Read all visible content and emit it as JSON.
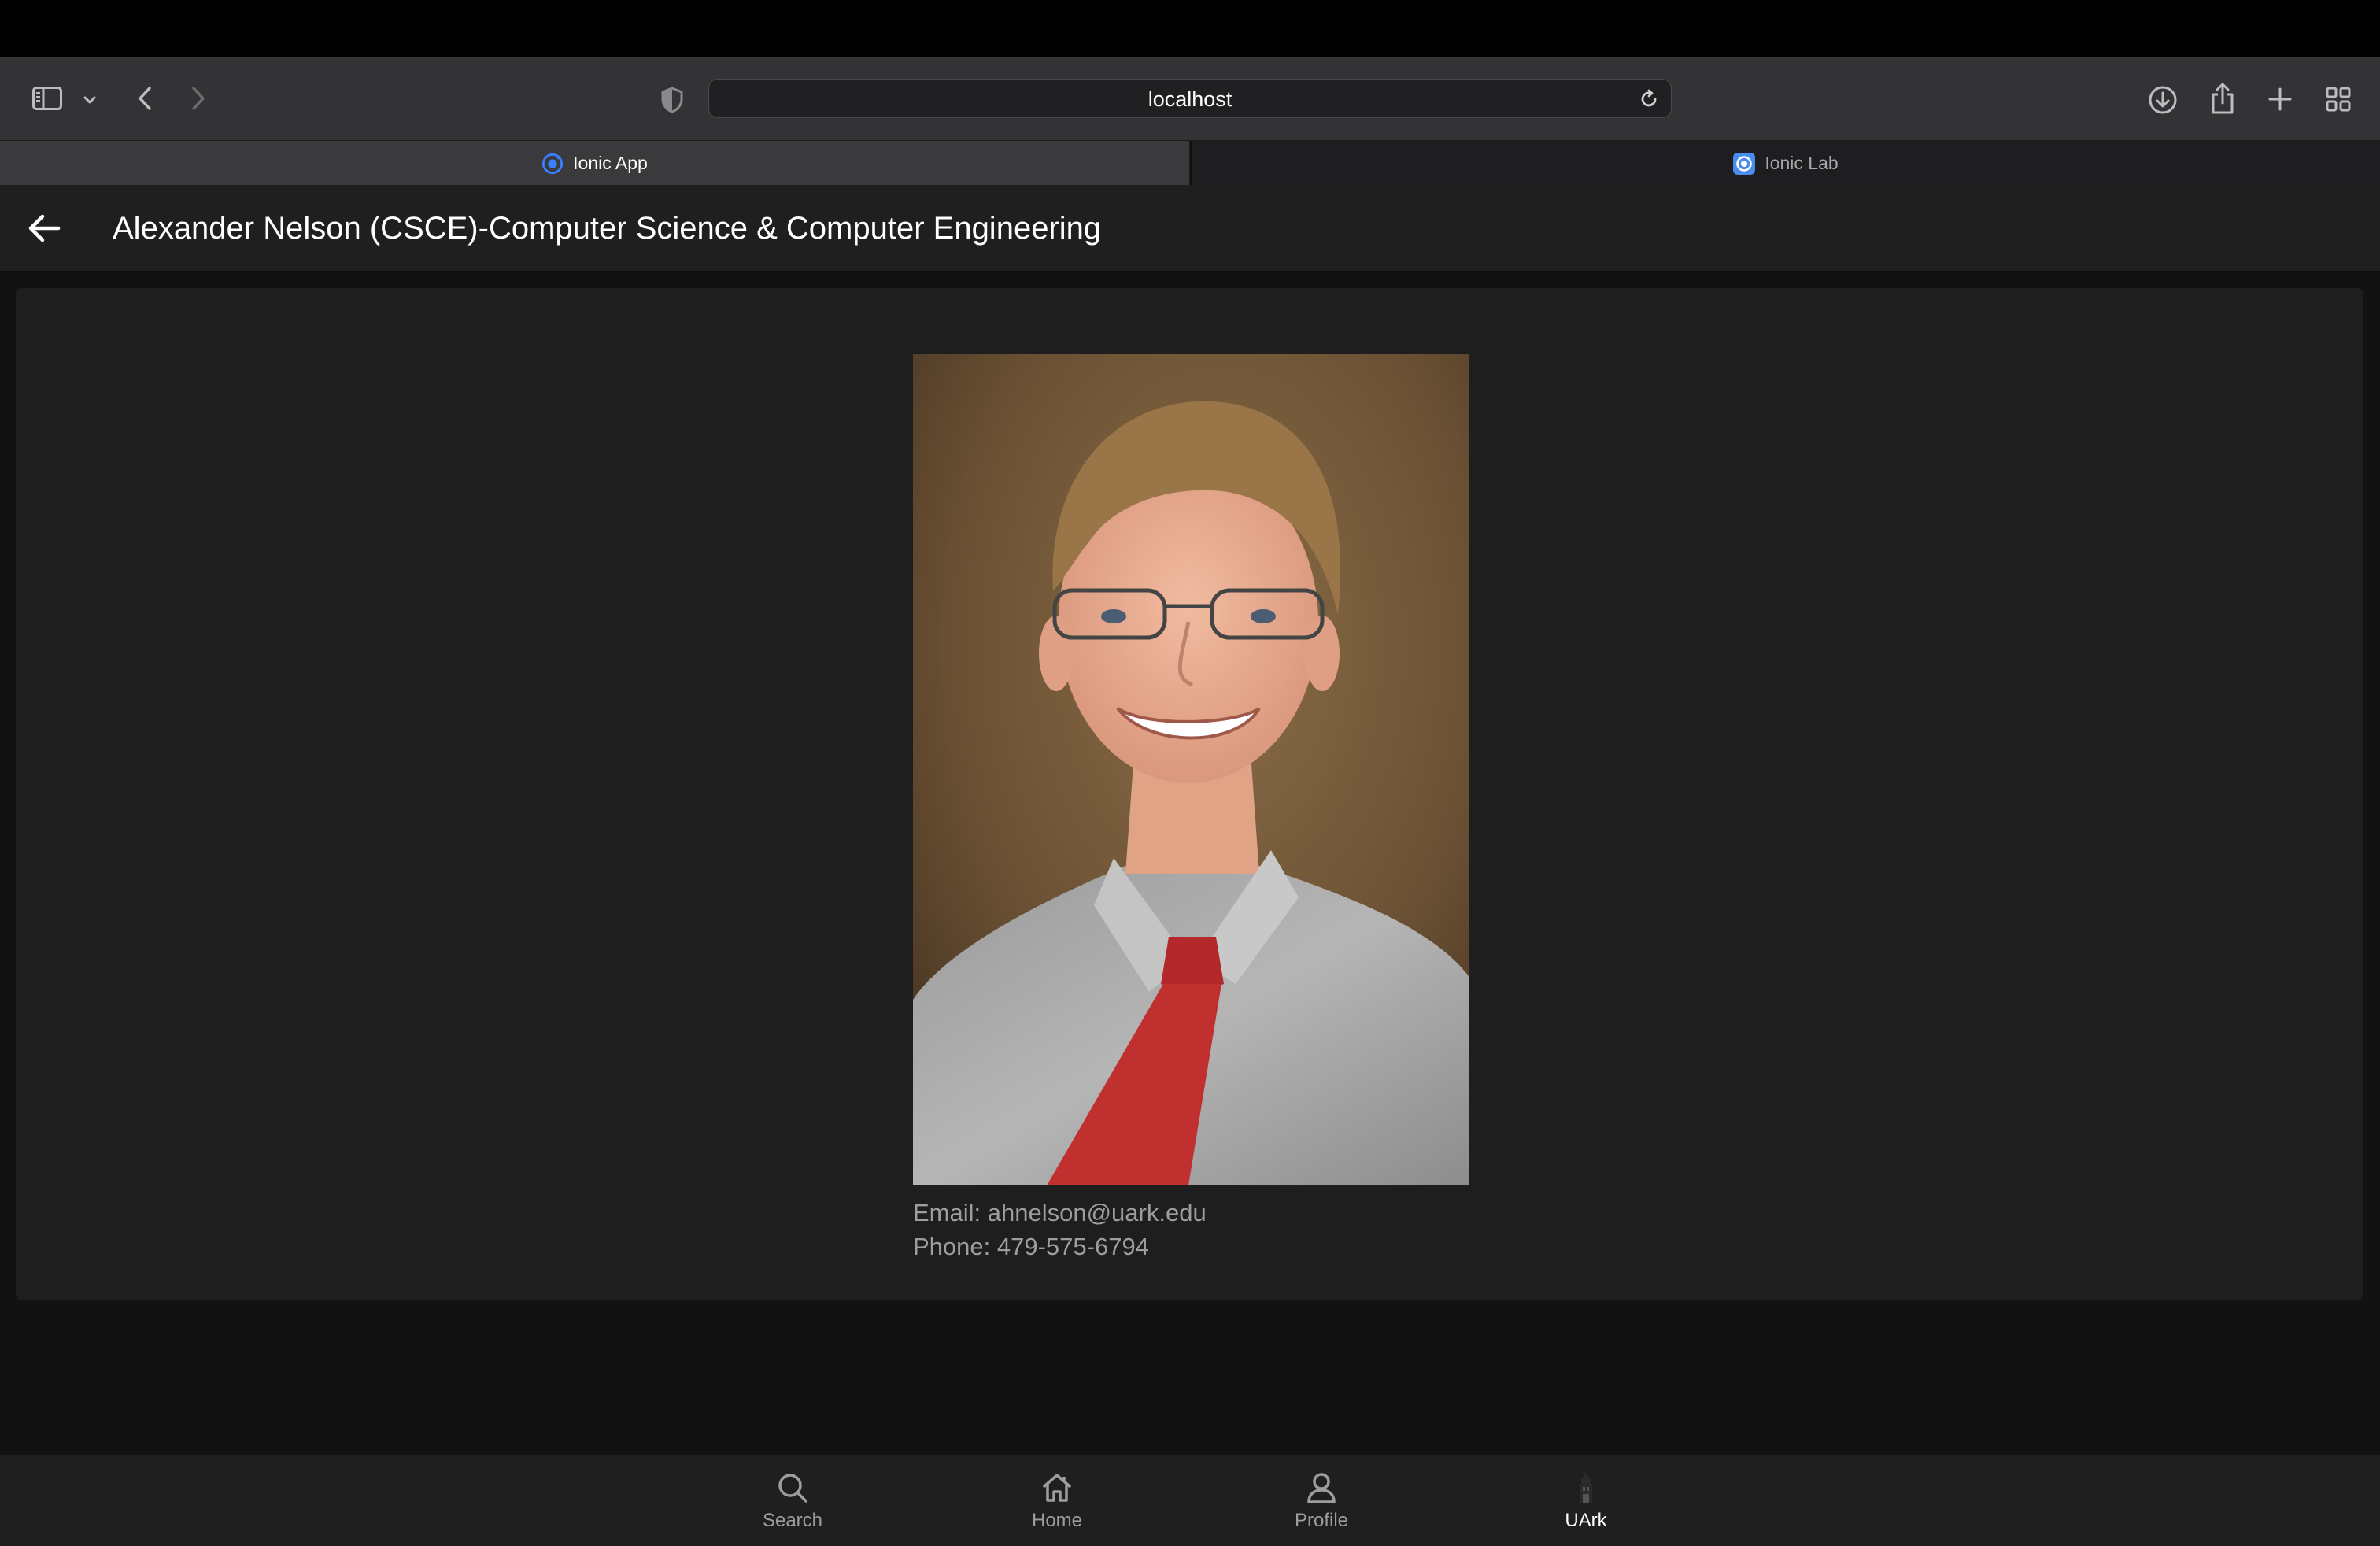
{
  "browser": {
    "address": "localhost",
    "tabs": [
      {
        "label": "Ionic App",
        "active": true
      },
      {
        "label": "Ionic Lab",
        "active": false
      }
    ]
  },
  "header": {
    "title": "Alexander Nelson (CSCE)-Computer Science & Computer Engineering"
  },
  "profile": {
    "email_line": "Email: ahnelson@uark.edu",
    "phone_line": "Phone: 479-575-6794"
  },
  "bottom_tabs": [
    {
      "label": "Search",
      "icon": "search-icon",
      "selected": false
    },
    {
      "label": "Home",
      "icon": "home-icon",
      "selected": false
    },
    {
      "label": "Profile",
      "icon": "person-icon",
      "selected": false
    },
    {
      "label": "UArk",
      "icon": "uark-tower-icon",
      "selected": true
    }
  ],
  "colors": {
    "accent_ionic": "#3880ff",
    "background": "#121212",
    "card": "#1e1e1e"
  }
}
